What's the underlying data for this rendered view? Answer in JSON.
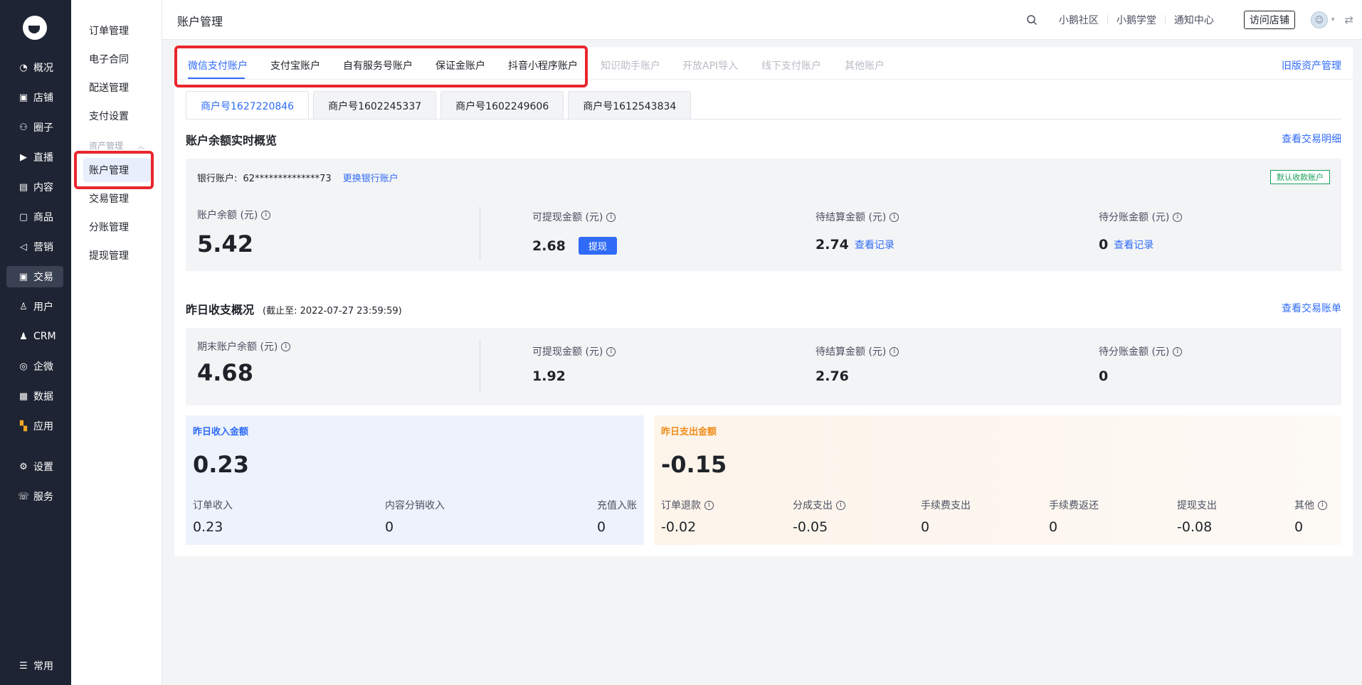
{
  "nav": {
    "items": [
      {
        "label": "概况",
        "icon": "pie-chart-icon",
        "glyph": "◔"
      },
      {
        "label": "店铺",
        "icon": "store-icon",
        "glyph": "▣"
      },
      {
        "label": "圈子",
        "icon": "group-icon",
        "glyph": "⚇"
      },
      {
        "label": "直播",
        "icon": "live-icon",
        "glyph": "▶"
      },
      {
        "label": "内容",
        "icon": "document-icon",
        "glyph": "▤"
      },
      {
        "label": "商品",
        "icon": "product-icon",
        "glyph": "▢"
      },
      {
        "label": "营销",
        "icon": "megaphone-icon",
        "glyph": "◁"
      },
      {
        "label": "交易",
        "icon": "transaction-icon",
        "glyph": "▣"
      },
      {
        "label": "用户",
        "icon": "user-icon",
        "glyph": "♙"
      },
      {
        "label": "CRM",
        "icon": "crm-icon",
        "glyph": "♟"
      },
      {
        "label": "企微",
        "icon": "wecom-icon",
        "glyph": "◎"
      },
      {
        "label": "数据",
        "icon": "data-icon",
        "glyph": "▦"
      },
      {
        "label": "应用",
        "icon": "apps-icon",
        "glyph": "▚"
      },
      {
        "label": "设置",
        "icon": "settings-icon",
        "glyph": "⚙"
      },
      {
        "label": "服务",
        "icon": "service-icon",
        "glyph": "☏"
      }
    ],
    "bottom": {
      "label": "常用",
      "icon": "list-icon",
      "glyph": "☰"
    }
  },
  "subnav": {
    "top_items": [
      "订单管理",
      "电子合同",
      "配送管理",
      "支付设置"
    ],
    "group_label": "资产管理",
    "group_items": [
      "账户管理",
      "交易管理",
      "分账管理",
      "提现管理"
    ]
  },
  "header": {
    "title": "账户管理",
    "links": [
      "小鹅社区",
      "小鹅学堂",
      "通知中心"
    ],
    "visit_store": "访问店铺"
  },
  "tabs": {
    "items": [
      "微信支付账户",
      "支付宝账户",
      "自有服务号账户",
      "保证金账户",
      "抖音小程序账户",
      "知识助手账户",
      "开放API导入",
      "线下支付账户",
      "其他账户"
    ],
    "old_link": "旧版资产管理"
  },
  "merchant_tabs": [
    "商户号1627220846",
    "商户号1602245337",
    "商户号1602249606",
    "商户号1612543834"
  ],
  "realtime": {
    "title": "账户余额实时概览",
    "link": "查看交易明细",
    "bank_label": "银行账户:",
    "bank_number": "62**************73",
    "change_bank": "更换银行账户",
    "default_badge": "默认收款账户",
    "balance_label": "账户余额 (元)",
    "balance": "5.42",
    "withdrawable_label": "可提现金额 (元)",
    "withdrawable": "2.68",
    "withdraw_btn": "提现",
    "pending_label": "待结算金额 (元)",
    "pending": "2.74",
    "split_label": "待分账金额 (元)",
    "split": "0",
    "view_records": "查看记录"
  },
  "yesterday": {
    "title": "昨日收支概况",
    "subtitle": "(截止至: 2022-07-27 23:59:59)",
    "link": "查看交易账单",
    "end_balance_label": "期末账户余额 (元)",
    "end_balance": "4.68",
    "withdrawable_label": "可提现金额 (元)",
    "withdrawable": "1.92",
    "pending_label": "待结算金额 (元)",
    "pending": "2.76",
    "split_label": "待分账金额 (元)",
    "split": "0"
  },
  "income": {
    "title": "昨日收入金额",
    "title_color": "#2f6bf7",
    "total": "0.23",
    "cols": [
      {
        "label": "订单收入",
        "value": "0.23"
      },
      {
        "label": "内容分销收入",
        "value": "0"
      },
      {
        "label": "充值入账",
        "value": "0"
      }
    ]
  },
  "expense": {
    "title": "昨日支出金额",
    "title_color": "#f08c1a",
    "total": "-0.15",
    "cols": [
      {
        "label": "订单退款",
        "value": "-0.02"
      },
      {
        "label": "分成支出",
        "value": "-0.05"
      },
      {
        "label": "手续费支出",
        "value": "0"
      },
      {
        "label": "手续费返还",
        "value": "0"
      },
      {
        "label": "提现支出",
        "value": "-0.08"
      },
      {
        "label": "其他",
        "value": "0"
      }
    ]
  }
}
